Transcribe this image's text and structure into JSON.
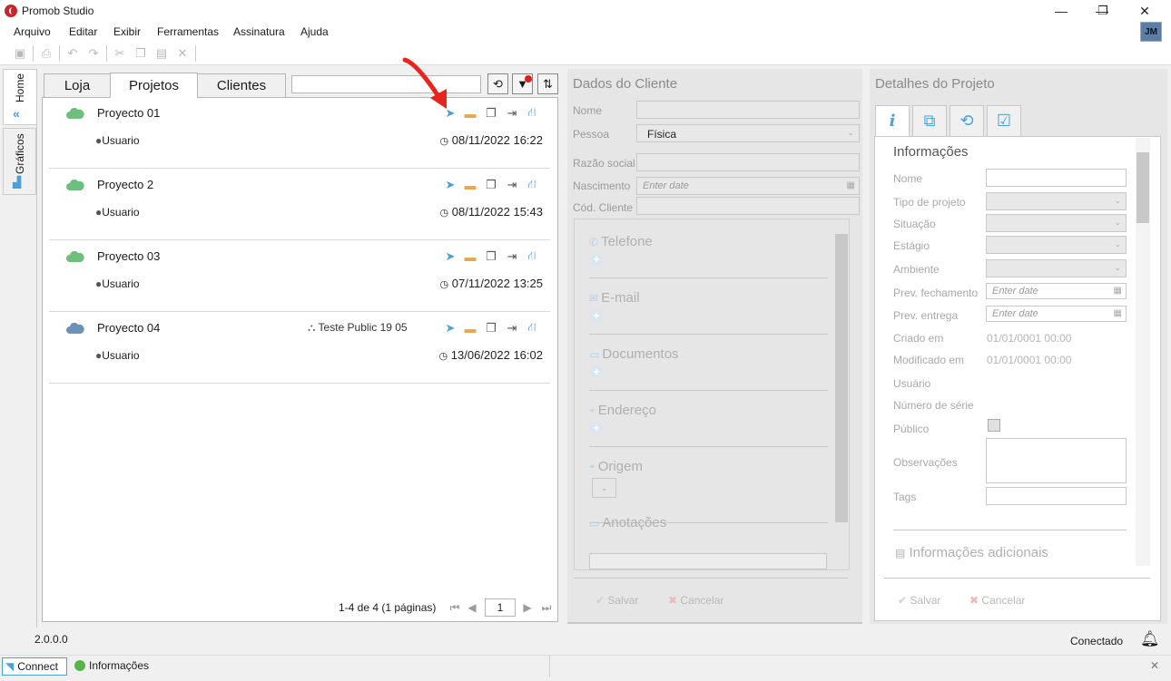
{
  "window": {
    "title": "Promob Studio",
    "minimize_glyph": "—",
    "maximize_glyph": "❐",
    "close_glyph": "✕"
  },
  "menu": [
    "Arquivo",
    "Editar",
    "Exibir",
    "Ferramentas",
    "Assinatura",
    "Ajuda"
  ],
  "user_initials": "JM",
  "sidebar": {
    "home_label": "Home",
    "charts_label": "Gráficos"
  },
  "tabs": [
    "Loja",
    "Projetos",
    "Clientes"
  ],
  "active_tab": "Projetos",
  "search": {
    "value": ""
  },
  "projects": [
    {
      "name": "Proyecto 01",
      "user": "Usuario",
      "date": "08/11/2022 16:22",
      "cloud_color": "#6cbf7c",
      "public": ""
    },
    {
      "name": "Proyecto 2",
      "user": "Usuario",
      "date": "08/11/2022 15:43",
      "cloud_color": "#6cbf7c",
      "public": ""
    },
    {
      "name": "Proyecto 03",
      "user": "Usuario",
      "date": "07/11/2022 13:25",
      "cloud_color": "#6cbf7c",
      "public": ""
    },
    {
      "name": "Proyecto 04",
      "user": "Usuario",
      "date": "13/06/2022 16:02",
      "cloud_color": "#6b93b8",
      "public": "Teste Public 19 05"
    }
  ],
  "pager": {
    "summary": "1-4 de 4 (1 páginas)",
    "page": "1"
  },
  "client": {
    "title": "Dados do Cliente",
    "fields": {
      "name": "Nome",
      "person": "Pessoa",
      "person_value": "Física",
      "company": "Razão social",
      "birth": "Nascimento",
      "birth_placeholder": "Enter date",
      "code": "Cód. Cliente"
    },
    "groups": [
      "Telefone",
      "E-mail",
      "Documentos",
      "Endereço",
      "Origem",
      "Anotações"
    ],
    "save": "Salvar",
    "cancel": "Cancelar"
  },
  "details": {
    "title": "Detalhes do Projeto",
    "section": "Informações",
    "labels": [
      "Nome",
      "Tipo de projeto",
      "Situação",
      "Estágio",
      "Ambiente",
      "Prev. fechamento",
      "Prev. entrega",
      "Criado em",
      "Modificado em",
      "Usuário",
      "Número de série",
      "Público",
      "Observações",
      "Tags"
    ],
    "date_placeholder": "Enter date",
    "created": "01/01/0001 00:00",
    "modified": "01/01/0001 00:00",
    "additional": "Informações adicionais",
    "save": "Salvar",
    "cancel": "Cancelar"
  },
  "version": "2.0.0.0",
  "connection_status": "Conectado",
  "taskbar": {
    "connect": "Connect",
    "info": "Informações"
  },
  "colors": {
    "accent_blue": "#4aa0d8",
    "annotation_arrow": "#e8241c"
  }
}
